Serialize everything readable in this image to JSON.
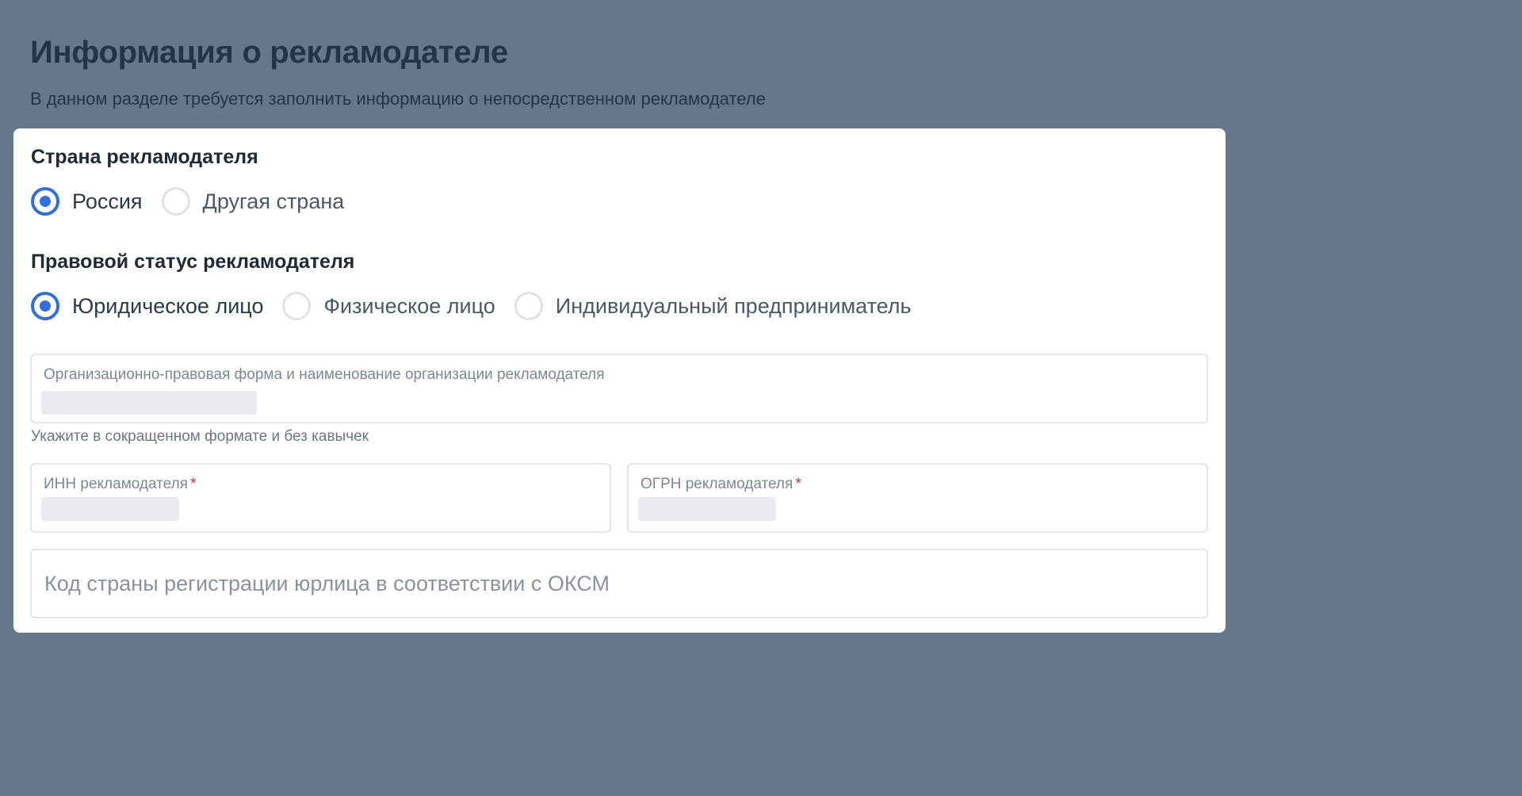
{
  "header": {
    "title": "Информация о рекламодателе",
    "subtitle": "В данном разделе требуется заполнить информацию о непосредственном рекламодателе"
  },
  "country": {
    "title": "Страна рекламодателя",
    "options": [
      {
        "label": "Россия",
        "checked": true
      },
      {
        "label": "Другая страна",
        "checked": false
      }
    ]
  },
  "legal_status": {
    "title": "Правовой статус рекламодателя",
    "options": [
      {
        "label": "Юридическое лицо",
        "checked": true
      },
      {
        "label": "Физическое лицо",
        "checked": false
      },
      {
        "label": "Индивидуальный предприниматель",
        "checked": false
      }
    ]
  },
  "fields": {
    "org_name": {
      "label": "Организационно-правовая форма и наименование организации рекламодателя",
      "value": "",
      "hint": "Укажите в сокращенном формате и без кавычек"
    },
    "inn": {
      "label": "ИНН рекламодателя",
      "required_mark": "*",
      "value": ""
    },
    "ogrn": {
      "label": "ОГРН рекламодателя",
      "required_mark": "*",
      "value": ""
    },
    "oksm": {
      "placeholder": "Код страны регистрации юрлица в соответствии с ОКСМ"
    }
  },
  "colors": {
    "background": "#66778a",
    "accent": "#2f6fe0",
    "required": "#d22c4a"
  }
}
